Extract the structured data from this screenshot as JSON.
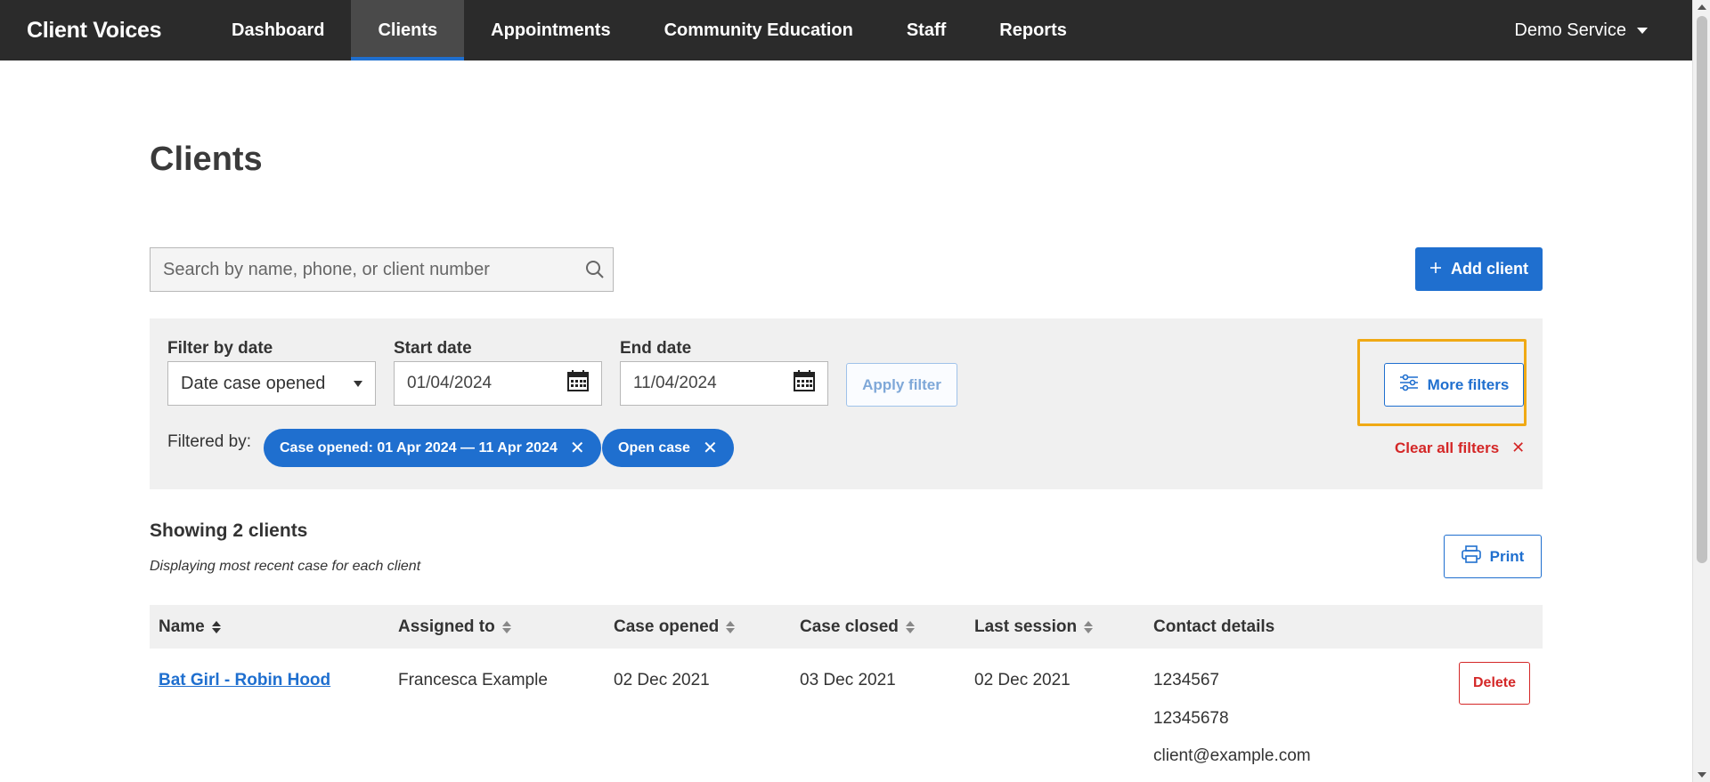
{
  "nav": {
    "brand": "Client Voices",
    "tabs": [
      {
        "label": "Dashboard",
        "active": false
      },
      {
        "label": "Clients",
        "active": true
      },
      {
        "label": "Appointments",
        "active": false
      },
      {
        "label": "Community Education",
        "active": false
      },
      {
        "label": "Staff",
        "active": false
      },
      {
        "label": "Reports",
        "active": false
      }
    ],
    "service": "Demo Service"
  },
  "page": {
    "title": "Clients"
  },
  "search": {
    "placeholder": "Search by name, phone, or client number",
    "value": ""
  },
  "toolbar": {
    "add_client_label": "Add client"
  },
  "filters": {
    "filter_by_date_label": "Filter by date",
    "filter_by_date_value": "Date case opened",
    "start_date_label": "Start date",
    "start_date_value": "01/04/2024",
    "end_date_label": "End date",
    "end_date_value": "11/04/2024",
    "apply_label": "Apply filter",
    "more_filters_label": "More filters",
    "filtered_by_label": "Filtered by:",
    "chips": [
      {
        "label": "Case opened: 01 Apr 2024 — 11 Apr 2024"
      },
      {
        "label": "Open case"
      }
    ],
    "clear_all_label": "Clear all filters"
  },
  "results": {
    "showing": "Showing 2 clients",
    "subtitle": "Displaying most recent case for each client",
    "print_label": "Print"
  },
  "table": {
    "columns": [
      "Name",
      "Assigned to",
      "Case opened",
      "Case closed",
      "Last session",
      "Contact details"
    ],
    "rows": [
      {
        "name": "Bat Girl - Robin Hood",
        "assigned_to": "Francesca Example",
        "case_opened": "02 Dec 2021",
        "case_closed": "03 Dec 2021",
        "last_session": "02 Dec 2021",
        "contact": [
          "1234567",
          "12345678",
          "client@example.com"
        ],
        "delete_label": "Delete"
      }
    ]
  },
  "colors": {
    "nav_bg": "#2b2b2b",
    "primary": "#1f6fcf",
    "danger": "#d42727",
    "highlight": "#f0a914",
    "panel_bg": "#f0f0f0"
  }
}
